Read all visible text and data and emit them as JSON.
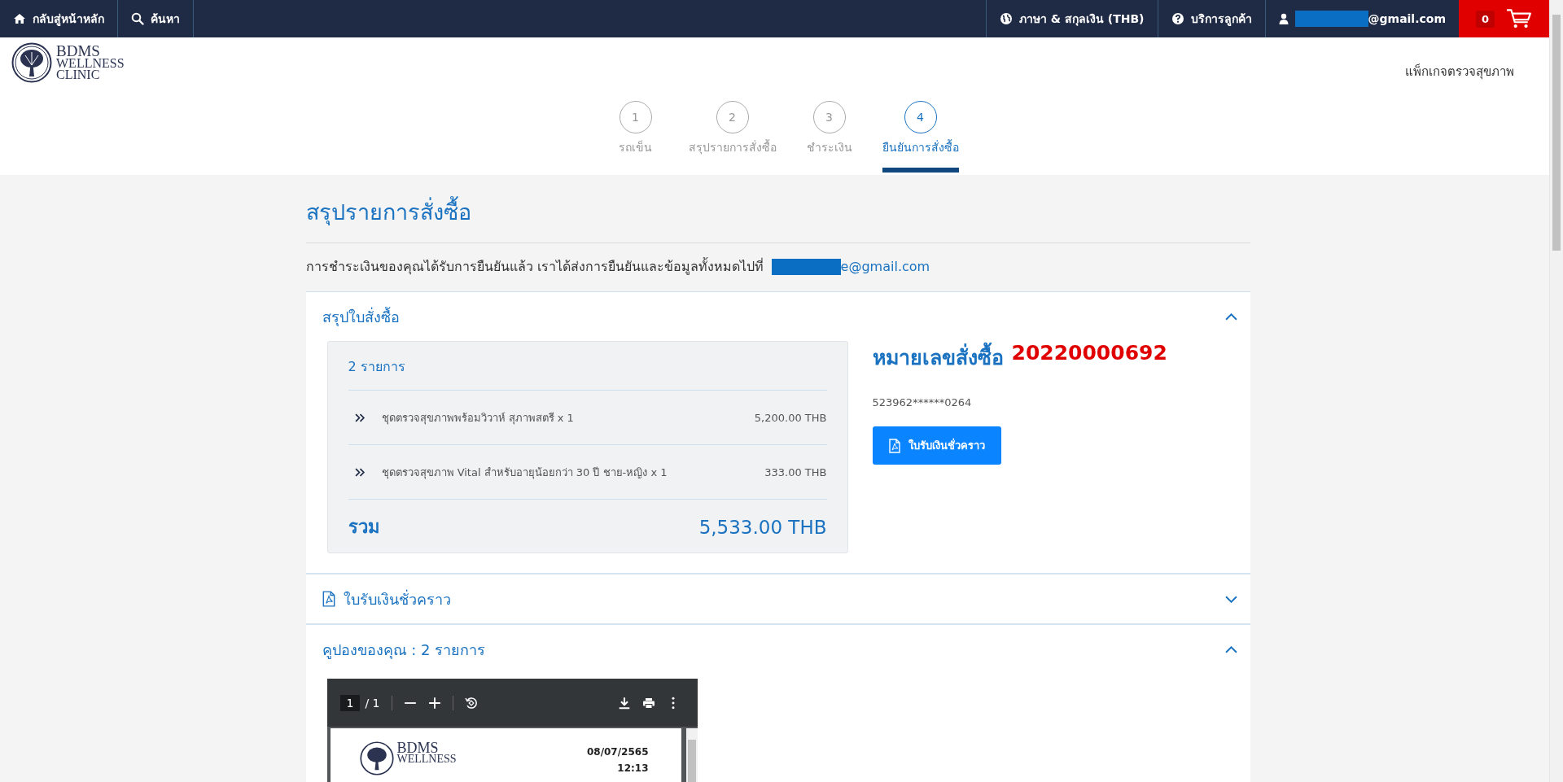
{
  "topbar": {
    "left": [
      {
        "kind": "home",
        "label": "กลับสู่หน้าหลัก"
      },
      {
        "kind": "search",
        "label": "ค้นหา"
      }
    ],
    "right": [
      {
        "kind": "globe",
        "label": "ภาษา & สกุลเงิน (THB)"
      },
      {
        "kind": "help",
        "label": "บริการลูกค้า"
      },
      {
        "kind": "user",
        "label": "@gmail.com"
      }
    ],
    "cart_count": "0"
  },
  "logo": [
    "BDMS",
    "WELLNESS",
    "CLINIC"
  ],
  "nav_link": "แพ็กเกจตรวจสุขภาพ",
  "steps": [
    {
      "number": "1",
      "label": "รถเข็น",
      "selected": false
    },
    {
      "number": "2",
      "label": "สรุปรายการสั่งซื้อ",
      "selected": false
    },
    {
      "number": "3",
      "label": "ชำระเงิน",
      "selected": false
    },
    {
      "number": "4",
      "label": "ยืนยันการสั่งซื้อ",
      "selected": true
    }
  ],
  "page_title": "สรุปรายการสั่งซื้อ",
  "confirmation": {
    "text": "การชำระเงินของคุณได้รับการยืนยันแล้ว เราได้ส่งการยืนยันและข้อมูลทั้งหมดไปที่",
    "email": "e@gmail.com"
  },
  "sections": [
    {
      "kind": "order",
      "title": "สรุปใบสั่งซื้อ",
      "expanded": true,
      "item_count": "2 รายการ",
      "items": [
        {
          "name": "ชุดตรวจสุขภาพพร้อมวิวาห์ สุภาพสตรี x 1",
          "price": "5,200.00 THB"
        },
        {
          "name": "ชุดตรวจสุขภาพ Vital สำหรับอายุน้อยกว่า 30 ปี ชาย-หญิง x 1",
          "price": "333.00 THB"
        }
      ],
      "total_label": "รวม",
      "total": "5,533.00 THB",
      "order_number_label": "หมายเลขสั่งซื้อ",
      "order_number": "20220000692",
      "card_number": "523962******0264",
      "receipt_button": "ใบรับเงินชั่วคราว"
    },
    {
      "kind": "receipt",
      "title": "ใบรับเงินชั่วคราว",
      "expanded": false
    },
    {
      "kind": "coupons",
      "title": "คูปองของคุณ : 2 รายการ",
      "expanded": true,
      "viewer": {
        "page": "1",
        "total": "/ 1",
        "logo": [
          "BDMS",
          "WELLNESS"
        ],
        "date": "08/07/2565",
        "time": "12:13"
      }
    }
  ]
}
